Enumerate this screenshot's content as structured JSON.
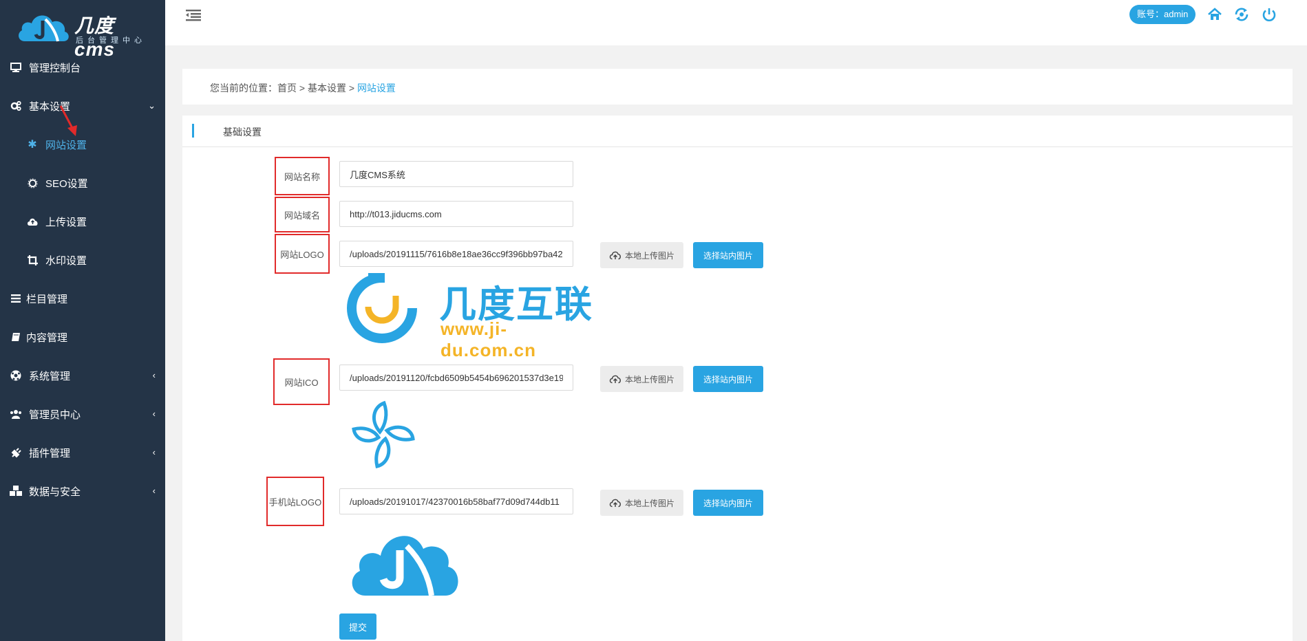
{
  "colors": {
    "accent": "#29a4e2",
    "sidebar_bg": "#243447",
    "highlight_border": "#e12a2a",
    "logo_yellow": "#f4b427"
  },
  "logo": {
    "brand": "几度cms",
    "subtitle": "后台管理中心"
  },
  "sidebar": {
    "items": [
      {
        "label": "管理控制台",
        "icon": "monitor-icon"
      },
      {
        "label": "基本设置",
        "icon": "gears-icon",
        "expanded": true
      },
      {
        "label": "网站设置",
        "icon": "asterisk-icon",
        "active": true
      },
      {
        "label": "SEO设置",
        "icon": "gear-icon"
      },
      {
        "label": "上传设置",
        "icon": "cloud-upload-icon"
      },
      {
        "label": "水印设置",
        "icon": "crop-icon"
      },
      {
        "label": "栏目管理",
        "icon": "list-icon"
      },
      {
        "label": "内容管理",
        "icon": "book-icon"
      },
      {
        "label": "系统管理",
        "icon": "soccer-icon"
      },
      {
        "label": "管理员中心",
        "icon": "users-icon"
      },
      {
        "label": "插件管理",
        "icon": "plug-icon"
      },
      {
        "label": "数据与安全",
        "icon": "cubes-icon"
      }
    ]
  },
  "header": {
    "account_label": "账号：admin",
    "icons": [
      "home-icon",
      "refresh-icon",
      "power-icon"
    ]
  },
  "breadcrumb": {
    "prefix": "您当前的位置：",
    "home": "首页",
    "sep1": " > ",
    "section": "基本设置",
    "sep2": " > ",
    "current": "网站设置"
  },
  "panel": {
    "title": "基础设置"
  },
  "form": {
    "site_name": {
      "label": "网站名称",
      "value": "几度CMS系统"
    },
    "site_domain": {
      "label": "网站域名",
      "value": "http://t013.jiducms.com"
    },
    "site_logo": {
      "label": "网站LOGO",
      "value": "/uploads/20191115/7616b8e18ae36cc9f396bb97ba42"
    },
    "site_ico": {
      "label": "网站ICO",
      "value": "/uploads/20191120/fcbd6509b5454b696201537d3e19"
    },
    "mobile_logo": {
      "label": "手机站LOGO",
      "value": "/uploads/20191017/42370016b58baf77d09d744db11"
    },
    "upload_local_label": "本地上传图片",
    "pick_site_label": "选择站内图片",
    "submit_label": "提交"
  },
  "logo_preview": {
    "text": "几度互联",
    "url": "www.ji-du.com.cn"
  }
}
